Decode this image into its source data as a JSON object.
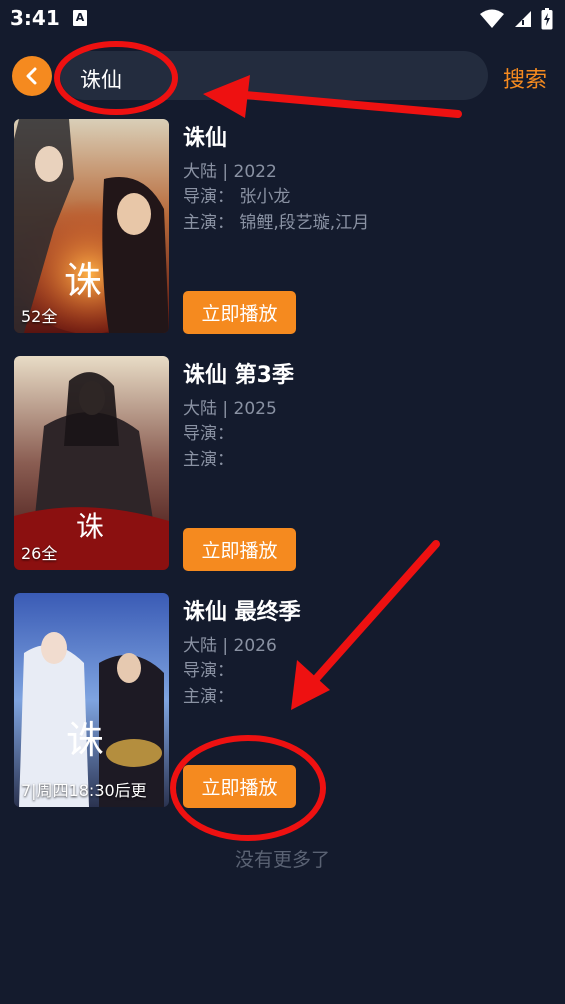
{
  "status_bar": {
    "time": "3:41",
    "notification_letter": "A",
    "icons": [
      "wifi-icon",
      "signal-icon",
      "battery-icon"
    ]
  },
  "header": {
    "back_icon": "chevron-left-icon",
    "search_value": "诛仙",
    "search_action": "搜索"
  },
  "results": [
    {
      "title": "诛仙",
      "region_year": "大陆 | 2022",
      "director": "导演：  张小龙",
      "cast": "主演：  锦鲤,段艺璇,江月",
      "badge": "52全",
      "play_label": "立即播放"
    },
    {
      "title": "诛仙 第3季",
      "region_year": "大陆 | 2025",
      "director": "导演：",
      "cast": "主演：",
      "badge": "26全",
      "play_label": "立即播放"
    },
    {
      "title": "诛仙 最终季",
      "region_year": "大陆 | 2026",
      "director": "导演：",
      "cast": "主演：",
      "badge": "7|周四18:30后更",
      "play_label": "立即播放"
    }
  ],
  "footer": {
    "no_more": "没有更多了"
  },
  "colors": {
    "background": "#141b2d",
    "accent": "#f58a1f",
    "annotation": "#ee1111"
  }
}
